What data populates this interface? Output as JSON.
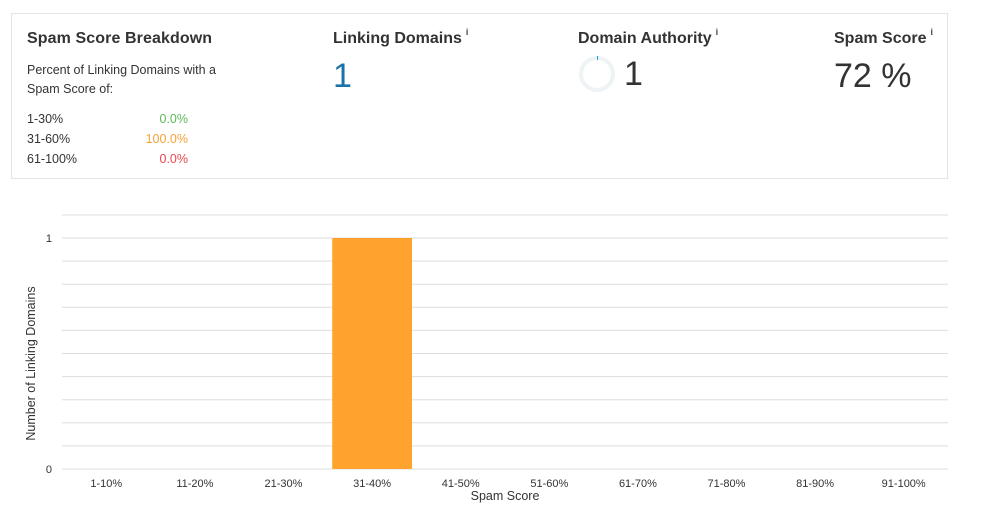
{
  "breakdown": {
    "title": "Spam Score Breakdown",
    "description": "Percent of Linking Domains with a Spam Score of:",
    "rows": [
      {
        "range": "1-30%",
        "percent": "0.0%",
        "color": "#5cb85c"
      },
      {
        "range": "31-60%",
        "percent": "100.0%",
        "color": "#f7a13a"
      },
      {
        "range": "61-100%",
        "percent": "0.0%",
        "color": "#e8464f"
      }
    ]
  },
  "metrics": {
    "linking_domains": {
      "title": "Linking Domains",
      "info": "i",
      "value": "1"
    },
    "domain_authority": {
      "title": "Domain Authority",
      "info": "i",
      "value": "1",
      "ring_fraction": 0.01
    },
    "spam_score": {
      "title": "Spam Score",
      "info": "i",
      "value": "72 %"
    }
  },
  "colors": {
    "bar": "#ffa22e",
    "accent_blue": "#1a73a8",
    "grid": "#dddddd"
  },
  "chart_data": {
    "type": "bar",
    "categories": [
      "1-10%",
      "11-20%",
      "21-30%",
      "31-40%",
      "41-50%",
      "51-60%",
      "61-70%",
      "71-80%",
      "81-90%",
      "91-100%"
    ],
    "values": [
      0,
      0,
      0,
      1,
      0,
      0,
      0,
      0,
      0,
      0
    ],
    "xlabel": "Spam Score",
    "ylabel": "Number of Linking Domains",
    "ylim": [
      0,
      1
    ],
    "yticks": [
      "0",
      "1"
    ],
    "grid": true
  }
}
